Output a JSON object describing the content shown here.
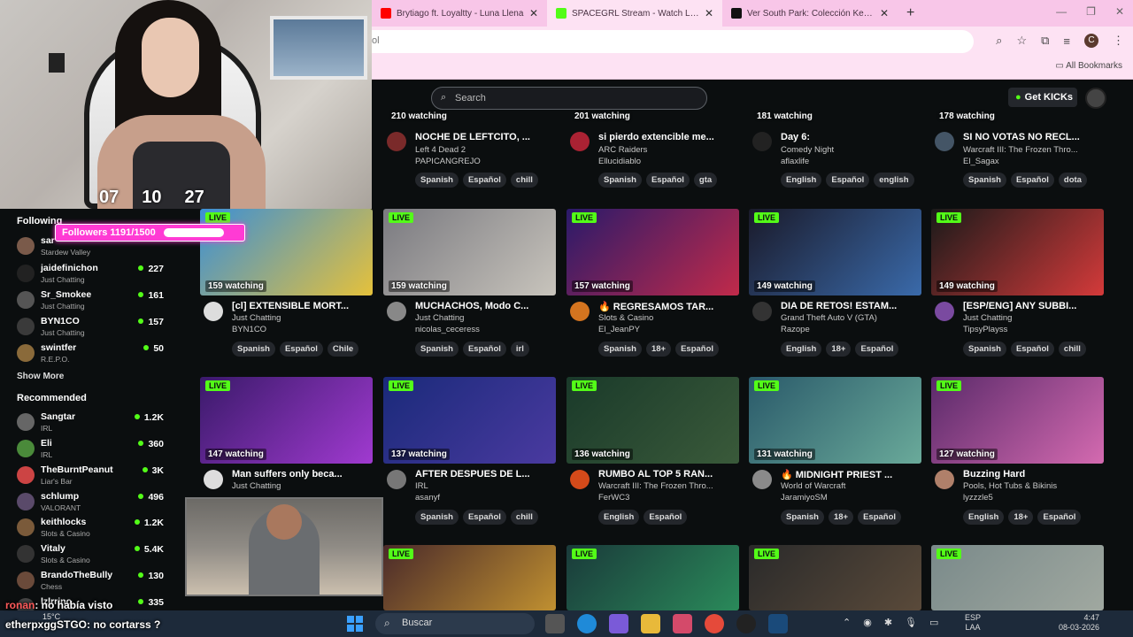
{
  "webcam": {
    "timer": [
      "07",
      "10",
      "27"
    ]
  },
  "browser": {
    "tabs": [
      {
        "title": "Brytiago ft. Loyaltty - Luna Llena",
        "favicon_color": "#ff0000",
        "active": false
      },
      {
        "title": "SPACEGRL Stream - Watch Live on Kick",
        "favicon_color": "#53fc18",
        "active": true
      },
      {
        "title": "Ver South Park: Colección Kenny",
        "favicon_color": "#111111",
        "active": false
      }
    ],
    "new_tab": "+",
    "address": "ol",
    "all_bookmarks": "All Bookmarks",
    "profile_initial": "C"
  },
  "kick": {
    "search_placeholder": "Search",
    "get_kicks": "Get KICKs",
    "accent": "#53fc18"
  },
  "sidebar": {
    "following_label": "Following",
    "followers_overlay": "Followers 1191/1500",
    "followers_progress": 0.794,
    "following": [
      {
        "name": "sar",
        "game": "Stardew Valley",
        "count": "",
        "color": "#7a5a4a"
      },
      {
        "name": "jaidefinichon",
        "game": "Just Chatting",
        "count": "227",
        "color": "#222"
      },
      {
        "name": "Sr_Smokee",
        "game": "Just Chatting",
        "count": "161",
        "color": "#555"
      },
      {
        "name": "BYN1CO",
        "game": "Just Chatting",
        "count": "157",
        "color": "#3a3a3a"
      },
      {
        "name": "swintfer",
        "game": "R.E.P.O.",
        "count": "50",
        "color": "#8a6a3a"
      }
    ],
    "show_more": "Show More",
    "recommended_label": "Recommended",
    "recommended": [
      {
        "name": "Sangtar",
        "game": "IRL",
        "count": "1.2K",
        "color": "#666"
      },
      {
        "name": "Eli",
        "game": "IRL",
        "count": "360",
        "color": "#4a8a3a"
      },
      {
        "name": "TheBurntPeanut",
        "game": "Liar's Bar",
        "count": "3K",
        "color": "#c44"
      },
      {
        "name": "schlump",
        "game": "VALORANT",
        "count": "496",
        "color": "#5a4a6a"
      },
      {
        "name": "keithlocks",
        "game": "Slots & Casino",
        "count": "1.2K",
        "color": "#7a5a3a"
      },
      {
        "name": "Vitaly",
        "game": "Slots & Casino",
        "count": "5.4K",
        "color": "#333"
      },
      {
        "name": "BrandoTheBully",
        "game": "Chess",
        "count": "130",
        "color": "#6a4a3a"
      },
      {
        "name": "lzlrrino",
        "game": "",
        "count": "335",
        "color": "#444"
      }
    ]
  },
  "streams_top": [
    {
      "watching": "210 watching",
      "title": "NOCHE DE LEFTCITO, ...",
      "category": "Left 4 Dead 2",
      "channel": "PAPICANGREJO",
      "tags": [
        "Spanish",
        "Español",
        "chill"
      ],
      "avatar_color": "#7a2a2a"
    },
    {
      "watching": "201 watching",
      "title": "si pierdo extencible me...",
      "category": "ARC Raiders",
      "channel": "Ellucidiablo",
      "tags": [
        "Spanish",
        "Español",
        "gta"
      ],
      "avatar_color": "#aa2233"
    },
    {
      "watching": "181 watching",
      "title": "Day 6:",
      "category": "Comedy Night",
      "channel": "aflaxlife",
      "tags": [
        "English",
        "Español",
        "english"
      ],
      "avatar_color": "#222"
    },
    {
      "watching": "178 watching",
      "title": "SI NO VOTAS NO RECL...",
      "category": "Warcraft III: The Frozen Thro...",
      "channel": "El_Sagax",
      "tags": [
        "Spanish",
        "Español",
        "dota"
      ],
      "avatar_color": "#445566"
    }
  ],
  "streams": [
    {
      "watching": "159 watching",
      "title": "[cl] EXTENSIBLE MORT...",
      "category": "Just Chatting",
      "channel": "BYN1CO",
      "tags": [
        "Spanish",
        "Español",
        "Chile"
      ],
      "thumb": [
        "#3b8fd6",
        "#e5c13b"
      ],
      "avatar_color": "#ddd"
    },
    {
      "watching": "159 watching",
      "title": "MUCHACHOS, Modo C...",
      "category": "Just Chatting",
      "channel": "nicolas_ceceress",
      "tags": [
        "Spanish",
        "Español",
        "irl"
      ],
      "thumb": [
        "#7a7a80",
        "#c8c4bc"
      ],
      "avatar_color": "#888"
    },
    {
      "watching": "157 watching",
      "title": "🔥 REGRESAMOS TAR...",
      "category": "Slots & Casino",
      "channel": "El_JeanPY",
      "tags": [
        "Spanish",
        "18+",
        "Español"
      ],
      "thumb": [
        "#2a1a6a",
        "#c12a4a"
      ],
      "avatar_color": "#d4741f"
    },
    {
      "watching": "149 watching",
      "title": "DIA DE RETOS! ESTAM...",
      "category": "Grand Theft Auto V (GTA)",
      "channel": "Razope",
      "tags": [
        "English",
        "18+",
        "Español"
      ],
      "thumb": [
        "#1a1a2a",
        "#3a6aaa"
      ],
      "avatar_color": "#333"
    },
    {
      "watching": "149 watching",
      "title": "[ESP/ENG] ANY SUBBI...",
      "category": "Just Chatting",
      "channel": "TipsyPlayss",
      "tags": [
        "Spanish",
        "Español",
        "chill"
      ],
      "thumb": [
        "#1a1a1a",
        "#d43a3a"
      ],
      "avatar_color": "#7a4aa0"
    },
    {
      "watching": "147 watching",
      "title": "Man suffers only beca...",
      "category": "Just Chatting",
      "channel": "",
      "tags": [],
      "thumb": [
        "#3a1a6a",
        "#a03ad0"
      ],
      "avatar_color": "#ddd"
    },
    {
      "watching": "137 watching",
      "title": "AFTER DESPUES DE L...",
      "category": "IRL",
      "channel": "asanyf",
      "tags": [
        "Spanish",
        "Español",
        "chill"
      ],
      "thumb": [
        "#1a2a7a",
        "#4a3aa0"
      ],
      "avatar_color": "#777"
    },
    {
      "watching": "136 watching",
      "title": "RUMBO AL TOP 5 RAN...",
      "category": "Warcraft III: The Frozen Thro...",
      "channel": "FerWC3",
      "tags": [
        "English",
        "Español"
      ],
      "thumb": [
        "#1a3a2a",
        "#3a5a3a"
      ],
      "avatar_color": "#d44a1a"
    },
    {
      "watching": "131 watching",
      "title": "🔥 MIDNIGHT PRIEST ...",
      "category": "World of Warcraft",
      "channel": "JaramiyoSM",
      "tags": [
        "Spanish",
        "18+",
        "Español"
      ],
      "thumb": [
        "#2a5a6a",
        "#6aaa9a"
      ],
      "avatar_color": "#8a8a8a"
    },
    {
      "watching": "127 watching",
      "title": "Buzzing Hard",
      "category": "Pools, Hot Tubs & Bikinis",
      "channel": "lyzzzle5",
      "tags": [
        "English",
        "18+",
        "Español"
      ],
      "thumb": [
        "#5a2a6a",
        "#d46ab0"
      ],
      "avatar_color": "#b0806a"
    }
  ],
  "streams_bottom": [
    {
      "thumb": [
        "#4a2a2a",
        "#c09030"
      ]
    },
    {
      "thumb": [
        "#1a3a3a",
        "#2a8a5a"
      ]
    },
    {
      "thumb": [
        "#2a2a2a",
        "#5a4a3a"
      ]
    },
    {
      "thumb": [
        "#7a8a8a",
        "#a0a8a0"
      ]
    }
  ],
  "live_label": "LIVE",
  "chat": [
    {
      "user": "ronan",
      "message": ": no había visto"
    },
    {
      "user": "etherpxggSTGO",
      "message": ": no cortarss ?"
    }
  ],
  "taskbar": {
    "weather": "15°C",
    "search": "Buscar",
    "lang_top": "ESP",
    "lang_bottom": "LAA",
    "time": "4:47",
    "date": "08-03-2026"
  }
}
